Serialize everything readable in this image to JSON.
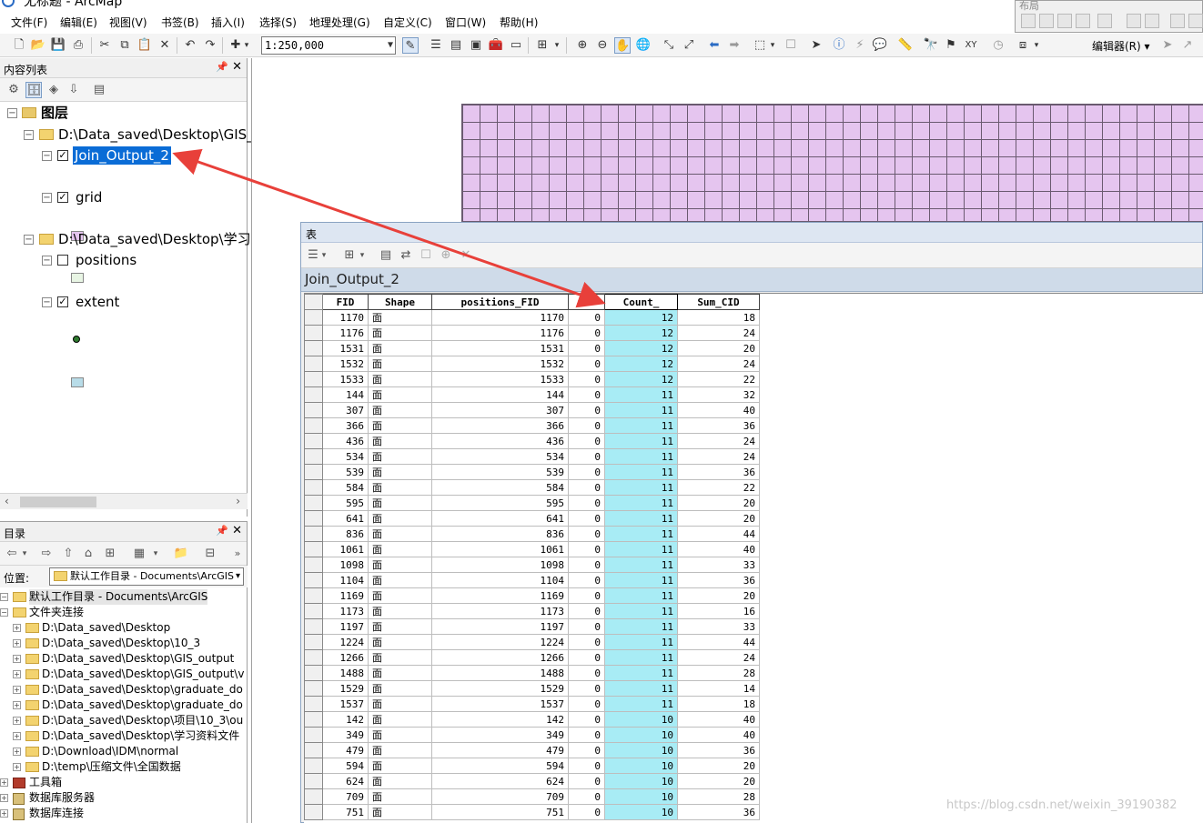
{
  "window": {
    "title": "无标题 - ArcMap"
  },
  "layout_toolbar": {
    "title": "布局"
  },
  "menu": [
    "文件(F)",
    "编辑(E)",
    "视图(V)",
    "书签(B)",
    "插入(I)",
    "选择(S)",
    "地理处理(G)",
    "自定义(C)",
    "窗口(W)",
    "帮助(H)"
  ],
  "toolbar": {
    "scale": "1:250,000",
    "editor_label": "编辑器(R)"
  },
  "toc": {
    "title": "内容列表",
    "root_label": "图层",
    "folder1": "D:\\Data_saved\\Desktop\\GIS_",
    "layer_selected": "Join_Output_2",
    "layer_grid": "grid",
    "folder2": "D:\\Data_saved\\Desktop\\学习",
    "layer_positions": "positions",
    "layer_extent": "extent",
    "swatch_colors": {
      "join": "#e5c5ef",
      "grid": "#e8f5e4",
      "positions": "#2f7a2f",
      "extent": "#b8dce8"
    }
  },
  "catalog": {
    "title": "目录",
    "location_label": "位置:",
    "location_value": "默认工作目录 - Documents\\ArcGIS",
    "items": [
      {
        "label": "默认工作目录 - Documents\\ArcGIS",
        "kind": "home-folder"
      },
      {
        "label": "文件夹连接",
        "kind": "folder-connections"
      },
      {
        "label": "D:\\Data_saved\\Desktop",
        "kind": "folder"
      },
      {
        "label": "D:\\Data_saved\\Desktop\\10_3",
        "kind": "folder"
      },
      {
        "label": "D:\\Data_saved\\Desktop\\GIS_output",
        "kind": "folder"
      },
      {
        "label": "D:\\Data_saved\\Desktop\\GIS_output\\v",
        "kind": "folder"
      },
      {
        "label": "D:\\Data_saved\\Desktop\\graduate_do",
        "kind": "folder"
      },
      {
        "label": "D:\\Data_saved\\Desktop\\graduate_do",
        "kind": "folder"
      },
      {
        "label": "D:\\Data_saved\\Desktop\\项目\\10_3\\ou",
        "kind": "folder"
      },
      {
        "label": "D:\\Data_saved\\Desktop\\学习资料文件",
        "kind": "folder"
      },
      {
        "label": "D:\\Download\\IDM\\normal",
        "kind": "folder"
      },
      {
        "label": "D:\\temp\\压缩文件\\全国数据",
        "kind": "folder"
      },
      {
        "label": "工具箱",
        "kind": "toolbox"
      },
      {
        "label": "数据库服务器",
        "kind": "db-server"
      },
      {
        "label": "数据库连接",
        "kind": "db-connection"
      }
    ]
  },
  "table_window": {
    "title": "表",
    "tab": "Join_Output_2",
    "columns": [
      "FID",
      "Shape",
      "positions_FID",
      "Id",
      "Count_",
      "Sum_CID"
    ],
    "rows": [
      [
        "1170",
        "面",
        "1170",
        "0",
        "12",
        "18"
      ],
      [
        "1176",
        "面",
        "1176",
        "0",
        "12",
        "24"
      ],
      [
        "1531",
        "面",
        "1531",
        "0",
        "12",
        "20"
      ],
      [
        "1532",
        "面",
        "1532",
        "0",
        "12",
        "24"
      ],
      [
        "1533",
        "面",
        "1533",
        "0",
        "12",
        "22"
      ],
      [
        "144",
        "面",
        "144",
        "0",
        "11",
        "32"
      ],
      [
        "307",
        "面",
        "307",
        "0",
        "11",
        "40"
      ],
      [
        "366",
        "面",
        "366",
        "0",
        "11",
        "36"
      ],
      [
        "436",
        "面",
        "436",
        "0",
        "11",
        "24"
      ],
      [
        "534",
        "面",
        "534",
        "0",
        "11",
        "24"
      ],
      [
        "539",
        "面",
        "539",
        "0",
        "11",
        "36"
      ],
      [
        "584",
        "面",
        "584",
        "0",
        "11",
        "22"
      ],
      [
        "595",
        "面",
        "595",
        "0",
        "11",
        "20"
      ],
      [
        "641",
        "面",
        "641",
        "0",
        "11",
        "20"
      ],
      [
        "836",
        "面",
        "836",
        "0",
        "11",
        "44"
      ],
      [
        "1061",
        "面",
        "1061",
        "0",
        "11",
        "40"
      ],
      [
        "1098",
        "面",
        "1098",
        "0",
        "11",
        "33"
      ],
      [
        "1104",
        "面",
        "1104",
        "0",
        "11",
        "36"
      ],
      [
        "1169",
        "面",
        "1169",
        "0",
        "11",
        "20"
      ],
      [
        "1173",
        "面",
        "1173",
        "0",
        "11",
        "16"
      ],
      [
        "1197",
        "面",
        "1197",
        "0",
        "11",
        "33"
      ],
      [
        "1224",
        "面",
        "1224",
        "0",
        "11",
        "44"
      ],
      [
        "1266",
        "面",
        "1266",
        "0",
        "11",
        "24"
      ],
      [
        "1488",
        "面",
        "1488",
        "0",
        "11",
        "28"
      ],
      [
        "1529",
        "面",
        "1529",
        "0",
        "11",
        "14"
      ],
      [
        "1537",
        "面",
        "1537",
        "0",
        "11",
        "18"
      ],
      [
        "142",
        "面",
        "142",
        "0",
        "10",
        "40"
      ],
      [
        "349",
        "面",
        "349",
        "0",
        "10",
        "40"
      ],
      [
        "479",
        "面",
        "479",
        "0",
        "10",
        "36"
      ],
      [
        "594",
        "面",
        "594",
        "0",
        "10",
        "20"
      ],
      [
        "624",
        "面",
        "624",
        "0",
        "10",
        "20"
      ],
      [
        "709",
        "面",
        "709",
        "0",
        "10",
        "28"
      ],
      [
        "751",
        "面",
        "751",
        "0",
        "10",
        "36"
      ]
    ]
  },
  "watermark": "https://blog.csdn.net/weixin_39190382",
  "colors": {
    "selected_column": "#a8ecf5",
    "annotation_arrow": "#e8403a",
    "selection_highlight": "#0a6cd6"
  }
}
